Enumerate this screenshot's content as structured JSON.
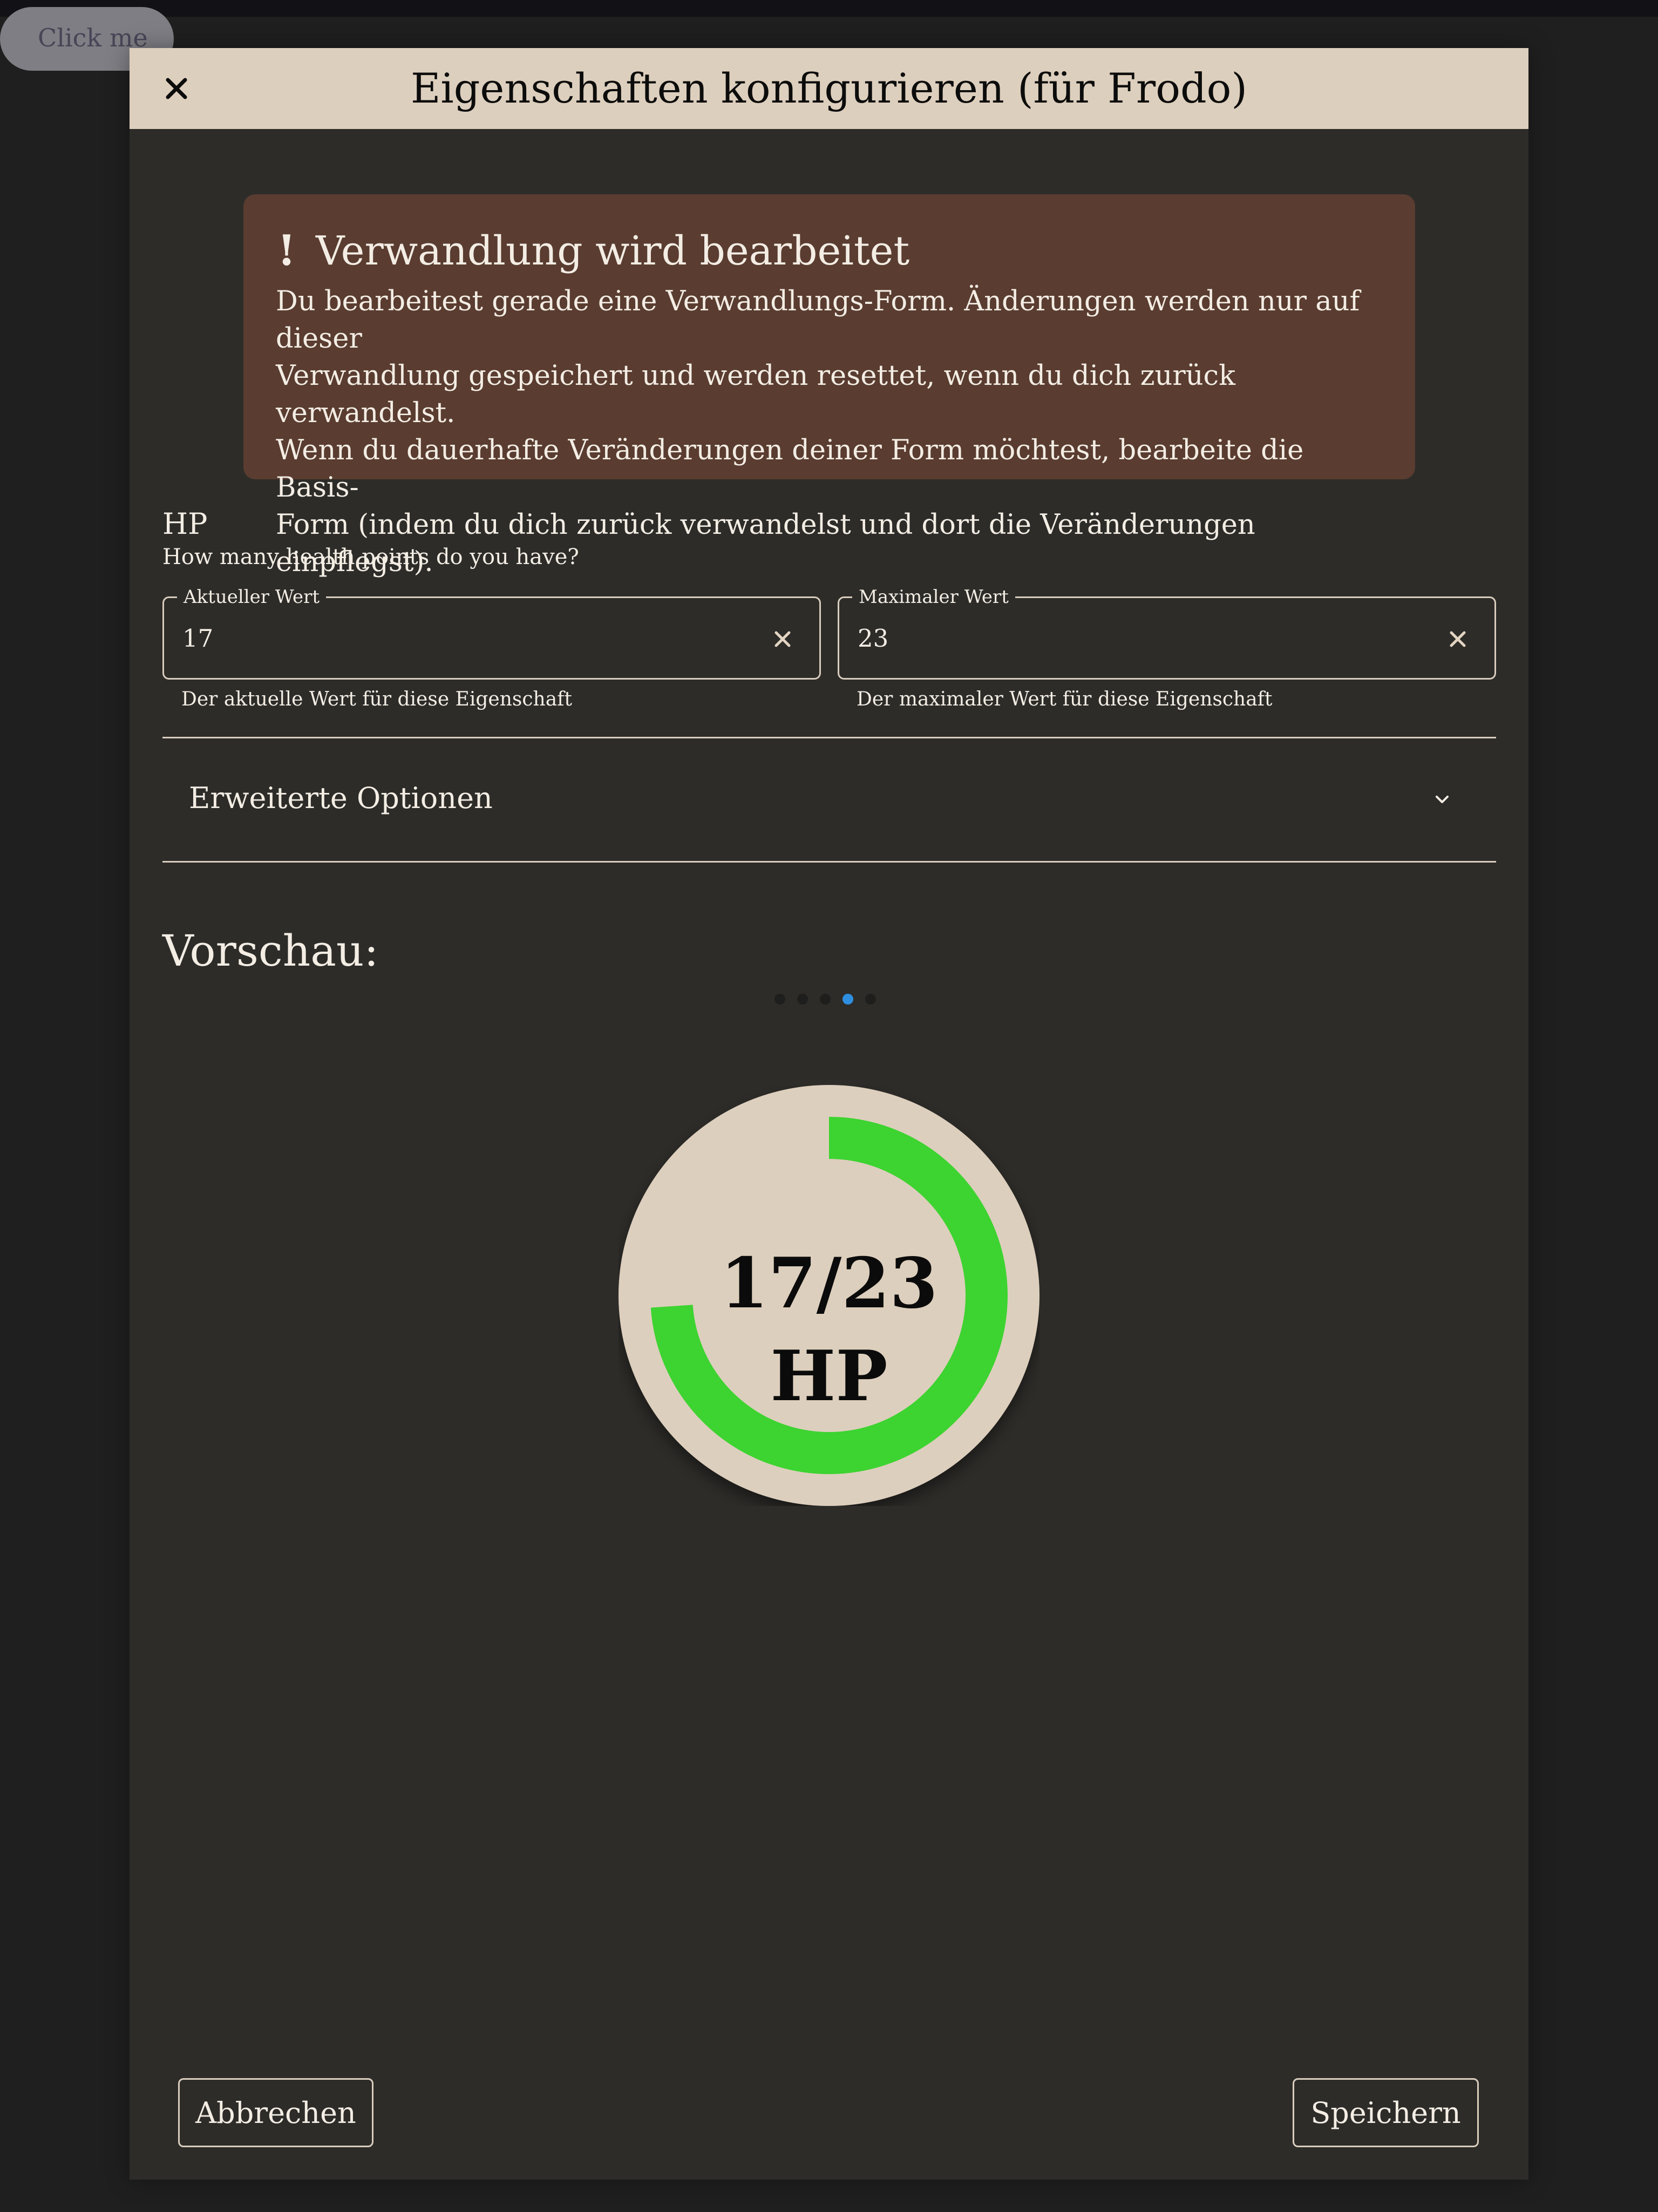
{
  "background_button": {
    "label": "Click me"
  },
  "dialog": {
    "title": "Eigenschaften konfigurieren (für Frodo)",
    "close_icon": "close-icon"
  },
  "alert": {
    "icon": "!",
    "title": "Verwandlung wird bearbeitet",
    "lines": [
      "Du bearbeitest gerade eine Verwandlungs-Form. Änderungen werden nur auf dieser",
      "Verwandlung gespeichert und werden resettet, wenn du dich zurück verwandelst.",
      "Wenn du dauerhafte Veränderungen deiner Form möchtest, bearbeite die Basis-",
      "Form (indem du dich zurück verwandelst und dort die Veränderungen einpflegst)."
    ]
  },
  "attribute": {
    "name": "HP",
    "description": "How many health points do you have?",
    "current": {
      "label": "Aktueller Wert",
      "value": "17",
      "helper": "Der aktuelle Wert für diese Eigenschaft"
    },
    "max": {
      "label": "Maximaler Wert",
      "value": "23",
      "helper": "Der maximaler Wert für diese Eigenschaft"
    }
  },
  "advanced": {
    "label": "Erweiterte Optionen",
    "icon": "chevron-down-icon"
  },
  "preview": {
    "label": "Vorschau:",
    "carousel": {
      "count": 5,
      "active_index": 3
    },
    "gauge": {
      "text": "17/23",
      "unit": "HP",
      "current": 17,
      "max": 23,
      "fill_color": "#3dd331",
      "background_color": "#ddcfbd"
    }
  },
  "footer": {
    "cancel_label": "Abbrechen",
    "save_label": "Speichern"
  }
}
